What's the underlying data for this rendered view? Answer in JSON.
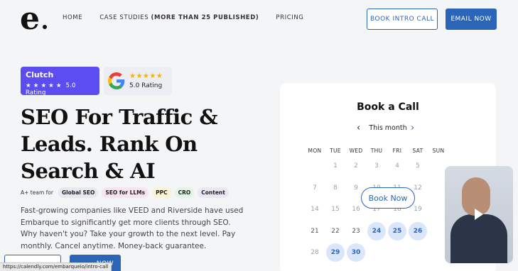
{
  "header": {
    "logo_letter": "e",
    "nav": [
      {
        "label": "HOME"
      },
      {
        "label": "CASE STUDIES ",
        "bold": "(MORE THAN 25 PUBLISHED)"
      },
      {
        "label": "PRICING"
      }
    ],
    "book_intro_call": "BOOK INTRO CALL",
    "email_now": "EMAIL NOW"
  },
  "badges": {
    "clutch_name": "Clutch",
    "clutch_stars": "★ ★ ★ ★ ★",
    "clutch_rating": "5.0 Rating",
    "google_stars": "★★★★★",
    "google_rating": "5.0 Rating"
  },
  "hero": {
    "headline_line1": "SEO For Traffic &",
    "headline_line2": "Leads. Rank On",
    "headline_line3": "Search & AI",
    "tags_lead": "A+ team for",
    "tags": [
      "Global SEO",
      "SEO for LLMs",
      "PPC",
      "CRO",
      "Content"
    ],
    "description": "Fast-growing companies like VEED and Riverside have used Embarque to significantly get more clients through SEO. Why haven't you? Take your growth to the next level. Pay monthly. Cancel anytime. Money-back guarantee.",
    "cta_partial": "NOW"
  },
  "status_bar_url": "https://calendly.com/embarqueio/intro-call",
  "calendar": {
    "title": "Book a Call",
    "month": "This month",
    "weekdays": [
      "MON",
      "TUE",
      "WED",
      "THU",
      "FRI",
      "SAT",
      "SUN"
    ],
    "rows": [
      [
        "",
        "1",
        "2",
        "3",
        "4",
        "5",
        ""
      ],
      [
        "7",
        "8",
        "9",
        "10",
        "11",
        "12",
        ""
      ],
      [
        "14",
        "15",
        "16",
        "17",
        "18",
        "19",
        ""
      ],
      [
        "21",
        "22",
        "23",
        "24",
        "25",
        "26",
        ""
      ],
      [
        "28",
        "29",
        "30",
        "",
        "",
        "",
        ""
      ]
    ],
    "available_days": [
      "24",
      "25",
      "26",
      "29",
      "30"
    ],
    "book_now": "Book Now"
  },
  "colors": {
    "accent": "#2a65b8",
    "clutch": "#5b4df0",
    "star": "#f5b400"
  }
}
